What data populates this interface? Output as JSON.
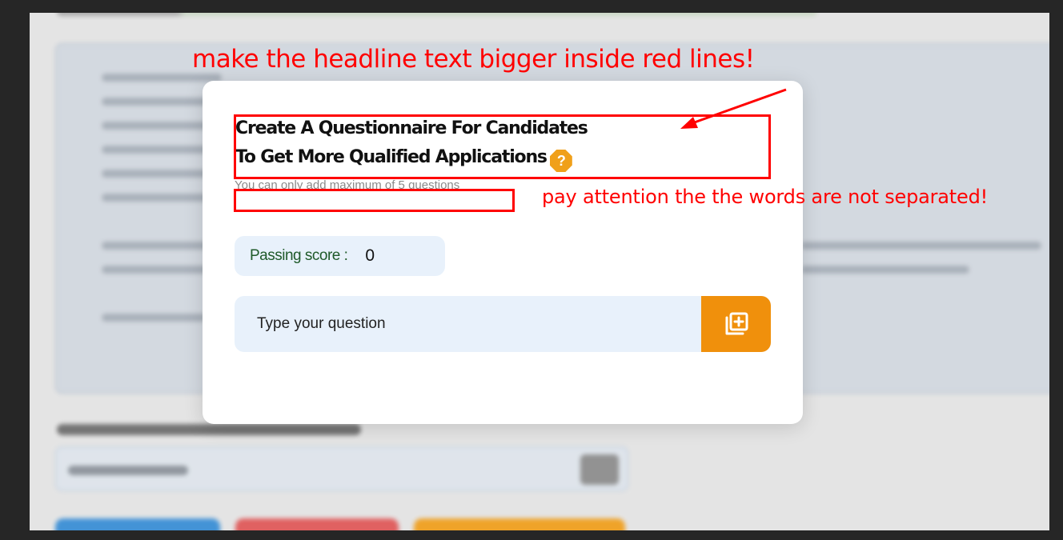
{
  "modal": {
    "headline_line1": "Create A Questionnaire For Candidates",
    "headline_line2": "To Get More Qualified Applications",
    "help_symbol": "?",
    "subtext": "You can only add maximum of 5 questions",
    "passing_score_label": "Passing score :",
    "passing_score_value": "0",
    "question_placeholder": "Type your question",
    "accent_color": "#f0900c"
  },
  "annotations": {
    "headline_note": "make the headline text bigger inside red lines!",
    "spacing_note": "pay attention the the words are not separated!",
    "color": "#ff0000"
  },
  "icons": {
    "help": "question-octagon-icon",
    "add": "add-library-icon"
  }
}
